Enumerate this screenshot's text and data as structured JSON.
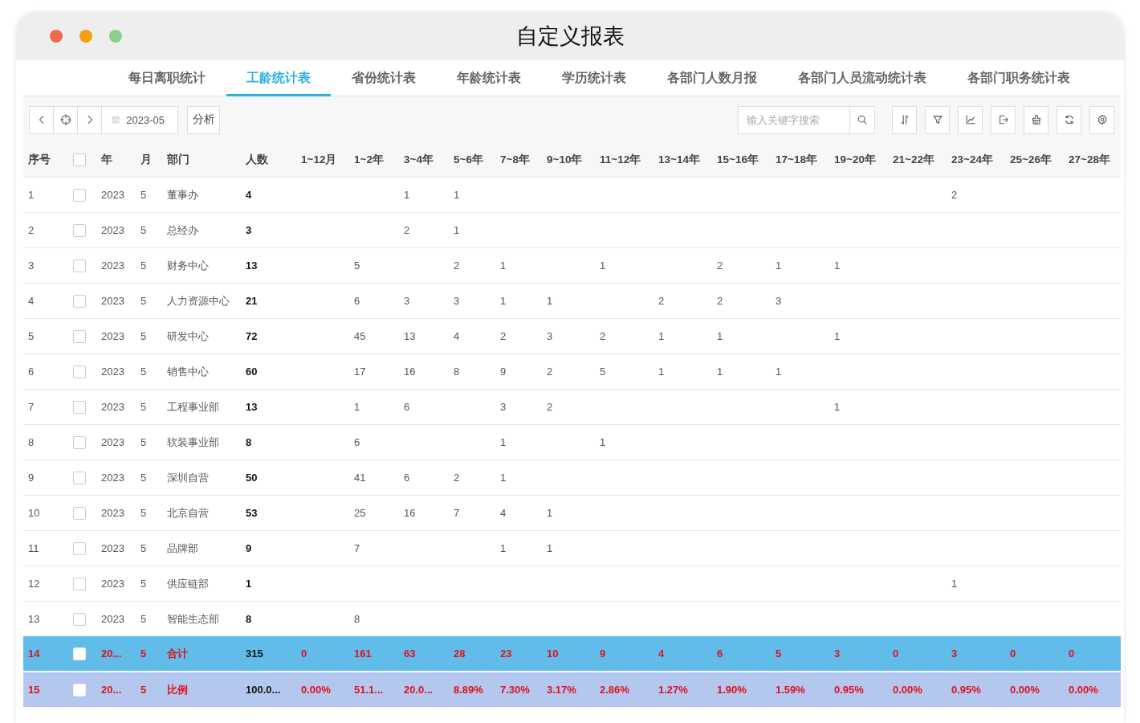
{
  "window": {
    "title": "自定义报表"
  },
  "tabs": [
    {
      "label": "每日离职统计",
      "selected": false
    },
    {
      "label": "工龄统计表",
      "selected": true
    },
    {
      "label": "省份统计表",
      "selected": false
    },
    {
      "label": "年龄统计表",
      "selected": false
    },
    {
      "label": "学历统计表",
      "selected": false
    },
    {
      "label": "各部门人数月报",
      "selected": false
    },
    {
      "label": "各部门人员流动统计表",
      "selected": false
    },
    {
      "label": "各部门职务统计表",
      "selected": false
    }
  ],
  "toolbar": {
    "date": "2023-05",
    "analyze_button": "分析",
    "search": {
      "placeholder": "输入关键字搜索"
    }
  },
  "table": {
    "select_all_checked": false,
    "columns": [
      "序号",
      "年",
      "月",
      "部门",
      "人数",
      "1~12月",
      "1~2年",
      "3~4年",
      "5~6年",
      "7~8年",
      "9~10年",
      "11~12年",
      "13~14年",
      "15~16年",
      "17~18年",
      "19~20年",
      "21~22年",
      "23~24年",
      "25~26年",
      "27~28年"
    ],
    "rows": [
      {
        "kind": "data",
        "checked": false,
        "no": "1",
        "year": "2023",
        "month": "5",
        "dept": "董事办",
        "total": "4",
        "counts": {
          "col_7": "1",
          "col_8": "1",
          "col_17": "2"
        }
      },
      {
        "kind": "data",
        "checked": false,
        "no": "2",
        "year": "2023",
        "month": "5",
        "dept": "总经办",
        "total": "3",
        "counts": {
          "col_7": "2",
          "col_8": "1"
        }
      },
      {
        "kind": "data",
        "checked": false,
        "no": "3",
        "year": "2023",
        "month": "5",
        "dept": "财务中心",
        "total": "13",
        "counts": {
          "col_6": "5",
          "col_8": "2",
          "col_9": "1",
          "col_11": "1",
          "col_13": "2",
          "col_14": "1",
          "col_15": "1"
        }
      },
      {
        "kind": "data",
        "checked": false,
        "no": "4",
        "year": "2023",
        "month": "5",
        "dept": "人力资源中心",
        "total": "21",
        "counts": {
          "col_6": "6",
          "col_7": "3",
          "col_8": "3",
          "col_9": "1",
          "col_10": "1",
          "col_12": "2",
          "col_13": "2",
          "col_14": "3"
        }
      },
      {
        "kind": "data",
        "checked": false,
        "no": "5",
        "year": "2023",
        "month": "5",
        "dept": "研发中心",
        "total": "72",
        "counts": {
          "col_6": "45",
          "col_7": "13",
          "col_8": "4",
          "col_9": "2",
          "col_10": "3",
          "col_11": "2",
          "col_12": "1",
          "col_13": "1",
          "col_15": "1"
        }
      },
      {
        "kind": "data",
        "checked": false,
        "no": "6",
        "year": "2023",
        "month": "5",
        "dept": "销售中心",
        "total": "60",
        "counts": {
          "col_6": "17",
          "col_7": "16",
          "col_8": "8",
          "col_9": "9",
          "col_10": "2",
          "col_11": "5",
          "col_12": "1",
          "col_13": "1",
          "col_14": "1"
        }
      },
      {
        "kind": "data",
        "checked": false,
        "no": "7",
        "year": "2023",
        "month": "5",
        "dept": "工程事业部",
        "total": "13",
        "counts": {
          "col_6": "1",
          "col_7": "6",
          "col_9": "3",
          "col_10": "2",
          "col_15": "1"
        }
      },
      {
        "kind": "data",
        "checked": false,
        "no": "8",
        "year": "2023",
        "month": "5",
        "dept": "软装事业部",
        "total": "8",
        "counts": {
          "col_6": "6",
          "col_9": "1",
          "col_11": "1"
        }
      },
      {
        "kind": "data",
        "checked": false,
        "no": "9",
        "year": "2023",
        "month": "5",
        "dept": "深圳自营",
        "total": "50",
        "counts": {
          "col_6": "41",
          "col_7": "6",
          "col_8": "2",
          "col_9": "1"
        }
      },
      {
        "kind": "data",
        "checked": false,
        "no": "10",
        "year": "2023",
        "month": "5",
        "dept": "北京自营",
        "total": "53",
        "counts": {
          "col_6": "25",
          "col_7": "16",
          "col_8": "7",
          "col_9": "4",
          "col_10": "1"
        }
      },
      {
        "kind": "data",
        "checked": false,
        "no": "11",
        "year": "2023",
        "month": "5",
        "dept": "品牌部",
        "total": "9",
        "counts": {
          "col_6": "7",
          "col_9": "1",
          "col_10": "1"
        }
      },
      {
        "kind": "data",
        "checked": false,
        "no": "12",
        "year": "2023",
        "month": "5",
        "dept": "供应链部",
        "total": "1",
        "counts": {
          "col_17": "1"
        }
      },
      {
        "kind": "data",
        "checked": false,
        "no": "13",
        "year": "2023",
        "month": "5",
        "dept": "智能生态部",
        "total": "8",
        "counts": {
          "col_6": "8"
        }
      },
      {
        "kind": "total",
        "checked": false,
        "no": "14",
        "year": "20...",
        "month": "5",
        "dept": "合计",
        "total": "315",
        "counts": {
          "col_5": "0",
          "col_6": "161",
          "col_7": "63",
          "col_8": "28",
          "col_9": "23",
          "col_10": "10",
          "col_11": "9",
          "col_12": "4",
          "col_13": "6",
          "col_14": "5",
          "col_15": "3",
          "col_16": "0",
          "col_17": "3",
          "col_18": "0",
          "col_19": "0"
        }
      },
      {
        "kind": "ratio",
        "checked": false,
        "no": "15",
        "year": "20...",
        "month": "5",
        "dept": "比例",
        "total": "100.0...",
        "counts": {
          "col_5": "0.00%",
          "col_6": "51.1...",
          "col_7": "20.0...",
          "col_8": "8.89%",
          "col_9": "7.30%",
          "col_10": "3.17%",
          "col_11": "2.86%",
          "col_12": "1.27%",
          "col_13": "1.90%",
          "col_14": "1.59%",
          "col_15": "0.95%",
          "col_16": "0.00%",
          "col_17": "0.95%",
          "col_18": "0.00%",
          "col_19": "0.00%"
        }
      }
    ]
  }
}
